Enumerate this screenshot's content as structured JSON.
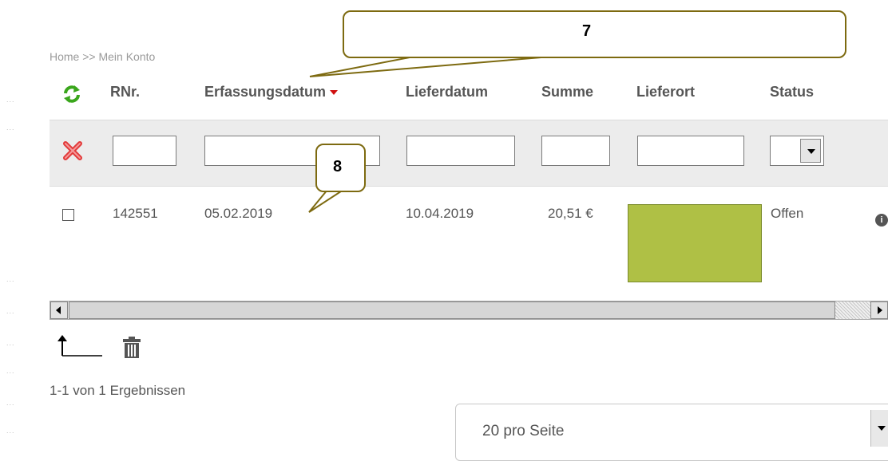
{
  "breadcrumb": "Home >> Mein Konto",
  "table": {
    "headers": [
      "RNr.",
      "Erfassungsdatum",
      "Lieferdatum",
      "Summe",
      "Lieferort",
      "Status"
    ],
    "sorted_column": "Erfassungsdatum",
    "sort_direction": "descending",
    "rows": [
      {
        "rnr": "142551",
        "erfassungsdatum": "05.02.2019",
        "lieferdatum": "10.04.2019",
        "summe": "20,51 €",
        "lieferort": "",
        "status": "Offen",
        "checked": false
      }
    ]
  },
  "filters": {
    "rnr": "",
    "erfassungsdatum": "",
    "lieferdatum": "",
    "summe": "",
    "lieferort": "",
    "status": ""
  },
  "result_count": "1-1 von 1 Ergebnissen",
  "per_page": "20 pro Seite",
  "callouts": {
    "header_callout": "7",
    "row_callout": "8"
  },
  "colors": {
    "redaction": "#afc045",
    "callout_border": "#7d6a10",
    "sort_arrow": "#d01010",
    "refresh_icon": "#3aa61c",
    "clear_icon": "#e23a3a"
  },
  "icons": {
    "refresh": "refresh-icon",
    "clear_filter": "clear-filter-icon",
    "info": "info-icon",
    "export": "export-arrow-icon",
    "delete": "trash-icon"
  }
}
